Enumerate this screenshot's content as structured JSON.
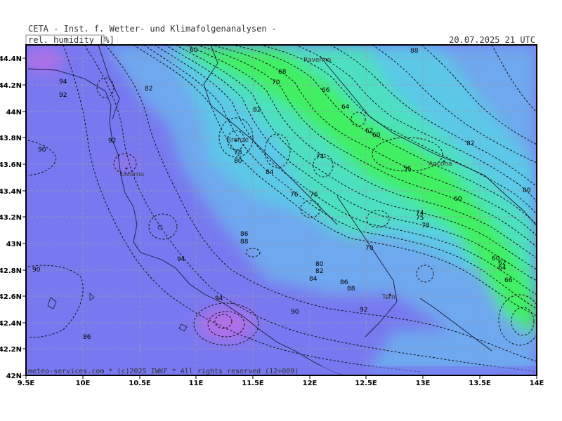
{
  "header": {
    "title": "CETA - Inst. f. Wetter- und Klimafolgenanalysen -",
    "parameter": "rel. humidity [%]",
    "valid_time": "20.07.2025 21 UTC"
  },
  "footer": {
    "credit": "meteo-services.com * (c)2025 IWKF * All rights reserved (12+009)"
  },
  "axes": {
    "x_ticks": [
      "9.5E",
      "10E",
      "10.5E",
      "11E",
      "11.5E",
      "12E",
      "12.5E",
      "13E",
      "13.5E",
      "14E"
    ],
    "y_ticks": [
      "44.4N",
      "44.2N",
      "44N",
      "43.8N",
      "43.6N",
      "43.4N",
      "43.2N",
      "43N",
      "42.8N",
      "42.6N",
      "42.4N",
      "42.2N",
      "42N"
    ]
  },
  "cities": [
    "Ravenna",
    "Firenze",
    "Livorno",
    "Ancona",
    "Terni"
  ],
  "contour_labels": [
    "60",
    "88",
    "94",
    "92",
    "90",
    "92",
    "82",
    "68",
    "70",
    "66",
    "64",
    "62",
    "60",
    "82",
    "78",
    "80",
    "84",
    "74",
    "56",
    "82",
    "80",
    "76",
    "76",
    "60",
    "74",
    "75",
    "78",
    "86",
    "88",
    "70",
    "80",
    "82",
    "84",
    "86",
    "88",
    "92",
    "90",
    "94",
    "86",
    "90",
    "94",
    "60",
    "62",
    "64",
    "66"
  ],
  "colors": {
    "humidity_90_plus": "#7878f0",
    "humidity_85_90": "#6ea8ee",
    "humidity_75_85": "#5cc8e8",
    "humidity_65_75": "#4ee0c0",
    "humidity_55_65": "#40f060",
    "humidity_95_plus": "#b070e8"
  }
}
